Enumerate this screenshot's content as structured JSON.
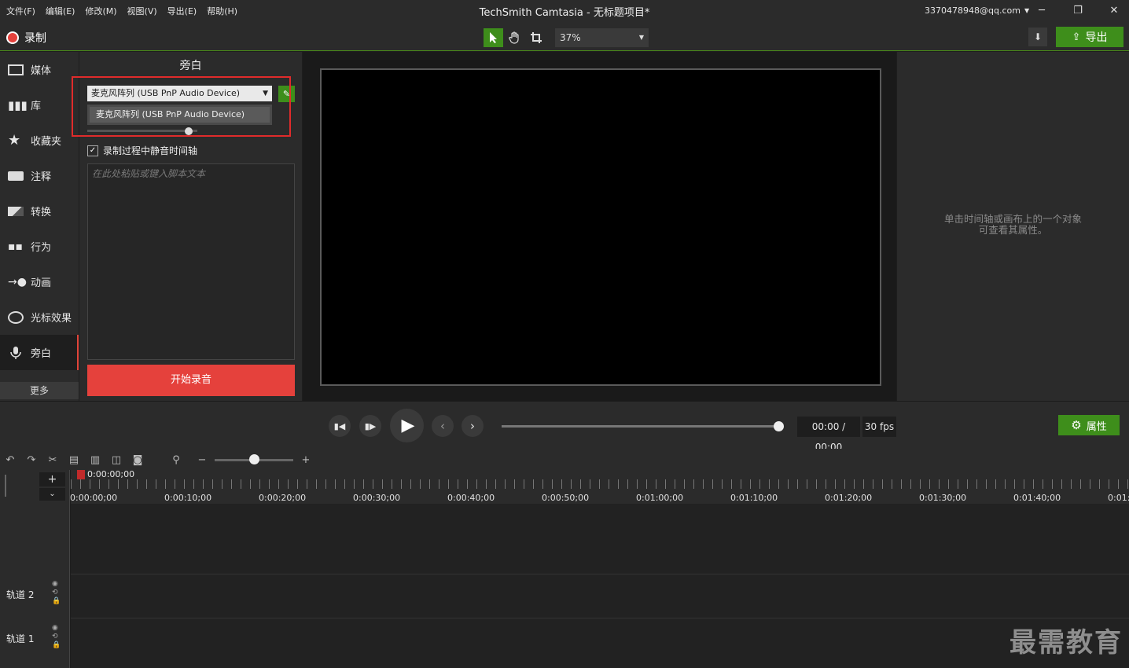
{
  "menu": [
    "文件(F)",
    "编辑(E)",
    "修改(M)",
    "视图(V)",
    "导出(E)",
    "帮助(H)"
  ],
  "window_title": "TechSmith Camtasia - 无标题项目*",
  "account": "3370478948@qq.com",
  "toolbar": {
    "record_label": "录制",
    "zoom": "37%",
    "export_label": "导出"
  },
  "sidebar": {
    "items": [
      {
        "label": "媒体",
        "icon": "media-icon"
      },
      {
        "label": "库",
        "icon": "library-icon"
      },
      {
        "label": "收藏夹",
        "icon": "star-icon"
      },
      {
        "label": "注释",
        "icon": "annotation-icon"
      },
      {
        "label": "转换",
        "icon": "transition-icon"
      },
      {
        "label": "行为",
        "icon": "behavior-icon"
      },
      {
        "label": "动画",
        "icon": "animation-icon"
      },
      {
        "label": "光标效果",
        "icon": "cursor-effect-icon"
      },
      {
        "label": "旁白",
        "icon": "microphone-icon"
      }
    ],
    "more_label": "更多"
  },
  "narration": {
    "title": "旁白",
    "device_selected": "麦克风阵列 (USB PnP Audio Device)",
    "device_option": "麦克风阵列 (USB PnP Audio Device)",
    "mute_label": "录制过程中静音时间轴",
    "script_placeholder": "在此处粘贴或键入脚本文本",
    "start_label": "开始录音"
  },
  "properties": {
    "hint_line1": "单击时间轴或画布上的一个对象",
    "hint_line2": "可查看其属性。",
    "button_label": "属性"
  },
  "playback": {
    "time": "00:00 / 00:00",
    "fps": "30 fps"
  },
  "timeline": {
    "playhead": "0:00:00;00",
    "ticks": [
      "0:00:00;00",
      "0:00:10;00",
      "0:00:20;00",
      "0:00:30;00",
      "0:00:40;00",
      "0:00:50;00",
      "0:01:00;00",
      "0:01:10;00",
      "0:01:20;00",
      "0:01:30;00",
      "0:01:40;00",
      "0:01:5"
    ],
    "tracks": [
      "轨道 2",
      "轨道 1"
    ]
  },
  "watermark": "最需教育",
  "colors": {
    "accent_green": "#3e8e1b",
    "record_red": "#e5413c",
    "highlight_red": "#e02b2b"
  }
}
